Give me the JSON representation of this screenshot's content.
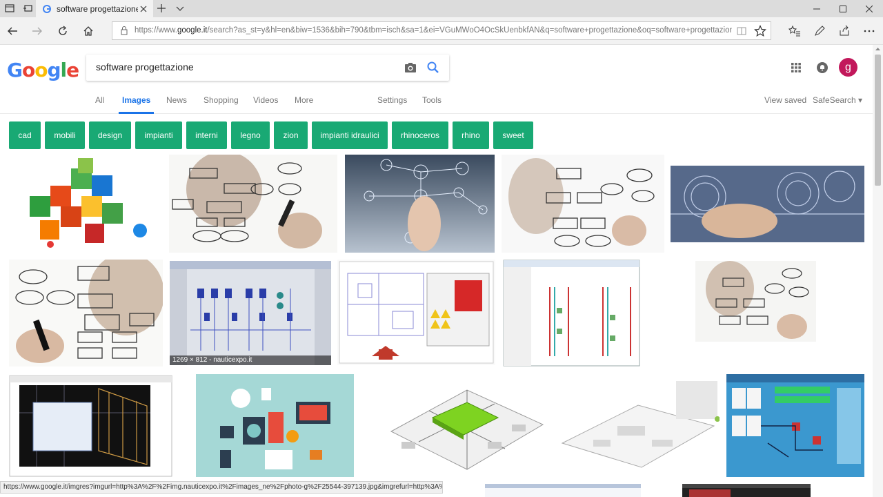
{
  "browser": {
    "tab_title": "software progettazione",
    "url_prefix": "https://www.",
    "url_domain": "google.it",
    "url_rest": "/search?as_st=y&hl=en&biw=1536&bih=790&tbm=isch&sa=1&ei=VGuMWoO4OcSkUenbkfAN&q=software+progettazione&oq=software+progettazione&gs"
  },
  "google": {
    "logo_letters": [
      "G",
      "o",
      "o",
      "g",
      "l",
      "e"
    ],
    "logo_colors": [
      "#4285f4",
      "#ea4335",
      "#fbbc05",
      "#4285f4",
      "#34a853",
      "#ea4335"
    ],
    "search_value": "software progettazione",
    "avatar_letter": "g",
    "tabs": [
      "All",
      "Images",
      "News",
      "Shopping",
      "Videos",
      "More"
    ],
    "active_tab": "Images",
    "tools": [
      "Settings",
      "Tools"
    ],
    "right_links": [
      "View saved",
      "SafeSearch ▾"
    ]
  },
  "chips": [
    "cad",
    "mobili",
    "design",
    "impianti",
    "interni",
    "legno",
    "zion",
    "impianti idraulici",
    "rhinoceros",
    "rhino",
    "sweet"
  ],
  "chip_color": "#19a974",
  "hover_caption": "1269 × 812 - nauticexpo.it",
  "status_url": "https://www.google.it/imgres?imgurl=http%3A%2F%2Fimg.nauticexpo.it%2Fimages_ne%2Fphoto-g%2F25544-397139.jpg&imgrefurl=http%3A%"
}
